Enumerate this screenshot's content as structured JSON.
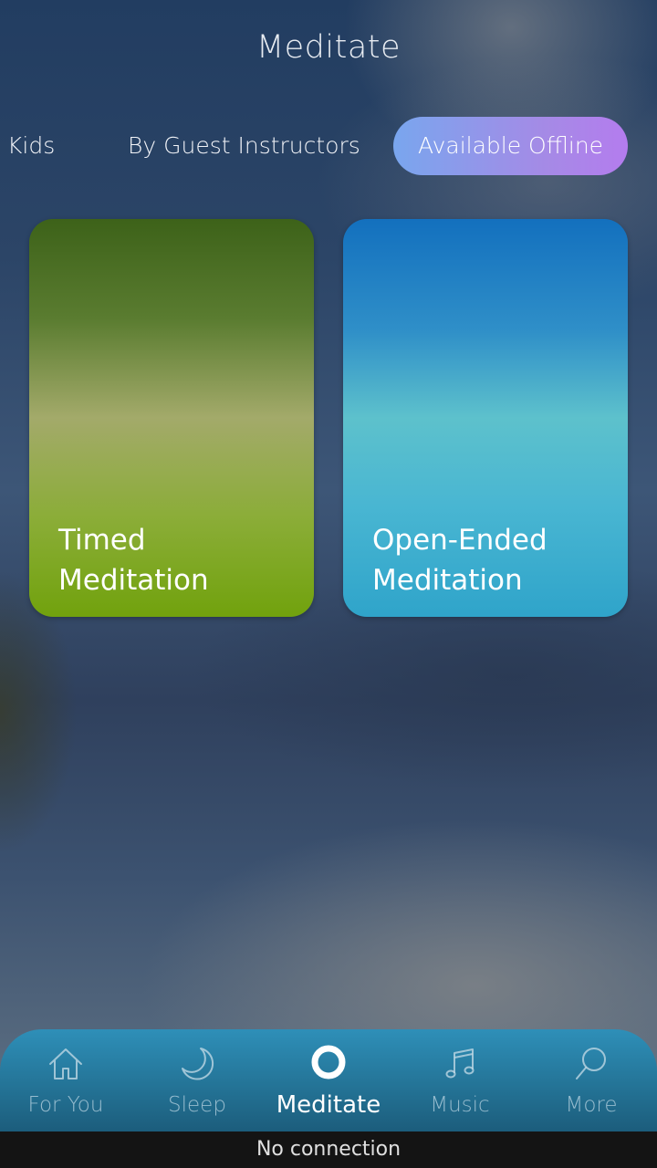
{
  "header": {
    "title": "Meditate"
  },
  "tabs": [
    {
      "label": "Kids",
      "selected": false
    },
    {
      "label": "By Guest Instructors",
      "selected": false
    },
    {
      "label": "Available Offline",
      "selected": true
    }
  ],
  "cards": [
    {
      "label_line1": "Timed",
      "label_line2": "Meditation",
      "gradient": [
        "#3d6219",
        "#a3aa6a",
        "#71a20d"
      ]
    },
    {
      "label_line1": "Open-Ended",
      "label_line2": "Meditation",
      "gradient": [
        "#1370be",
        "#5dc1cc",
        "#2fa4ca"
      ]
    }
  ],
  "bottom_nav": {
    "items": [
      {
        "label": "For You",
        "icon": "home-icon",
        "active": false
      },
      {
        "label": "Sleep",
        "icon": "moon-icon",
        "active": false
      },
      {
        "label": "Meditate",
        "icon": "ring-icon",
        "active": true
      },
      {
        "label": "Music",
        "icon": "music-note-icon",
        "active": false
      },
      {
        "label": "More",
        "icon": "search-icon",
        "active": false
      }
    ]
  },
  "status": {
    "text": "No connection"
  },
  "colors": {
    "accent_gradient_start": "#79a6ee",
    "accent_gradient_end": "#b47cee",
    "nav_background": "#247497"
  }
}
